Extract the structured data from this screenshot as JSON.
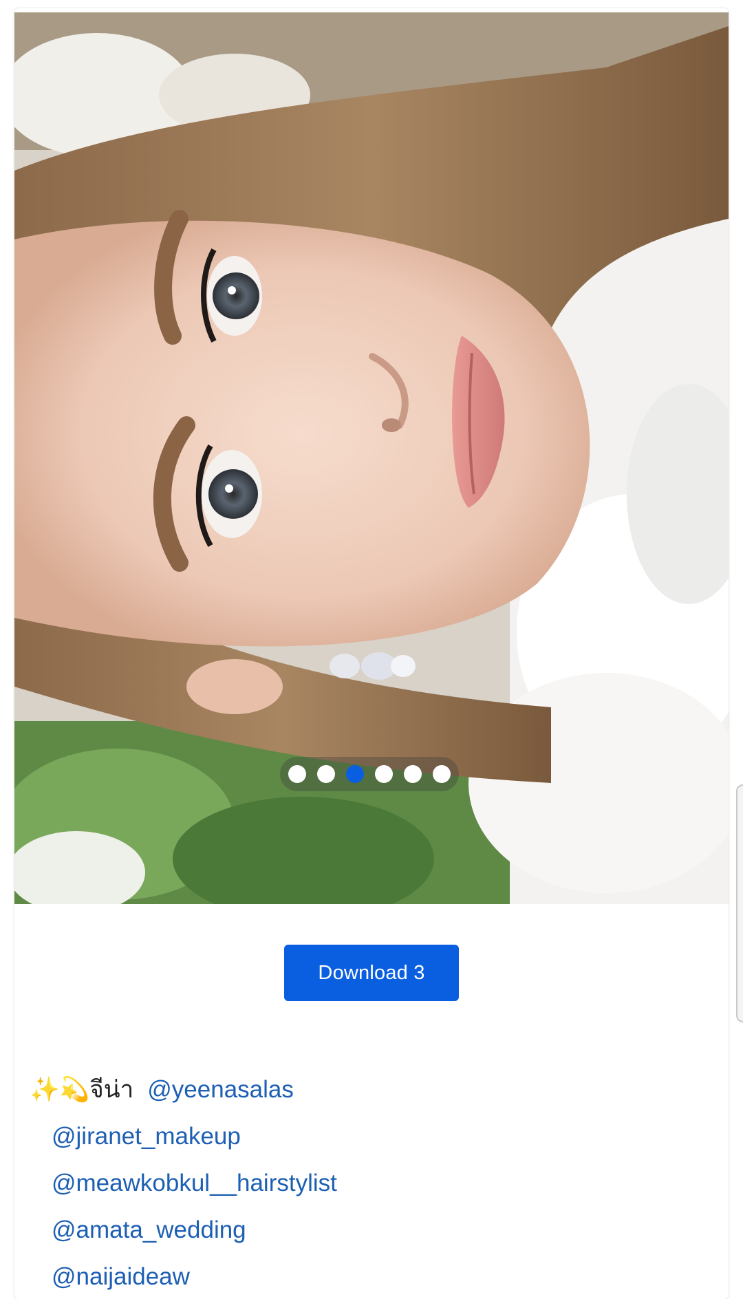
{
  "carousel": {
    "slide_count": 6,
    "active_index": 2,
    "active_color": "#0a5fe0",
    "inactive_color": "#ffffff"
  },
  "download": {
    "label": "Download 3",
    "color": "#0a5fe0"
  },
  "caption": {
    "emoji_sparkles": "✨",
    "emoji_dizzy": "💫",
    "name": "จีน่า",
    "mentions": [
      "@yeenasalas",
      "@jiranet_makeup",
      "@meawkobkul__hairstylist",
      "@amata_wedding",
      "@naijaideaw"
    ],
    "mention_color": "#1d5fb3"
  }
}
